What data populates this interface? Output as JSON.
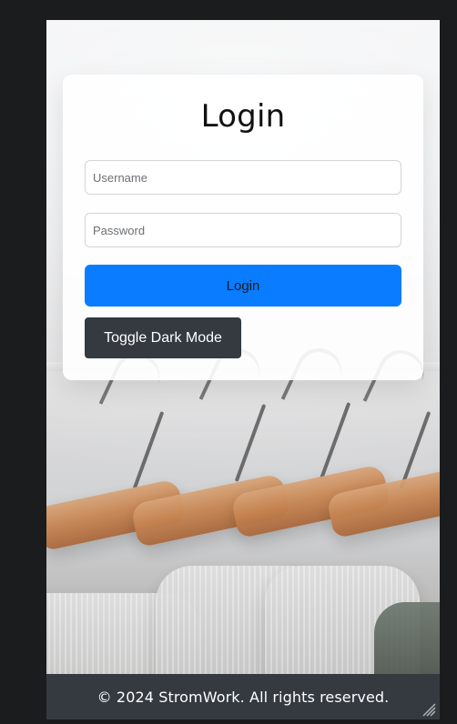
{
  "card": {
    "title": "Login",
    "fields": {
      "username_placeholder": "Username",
      "password_placeholder": "Password"
    },
    "buttons": {
      "login": "Login",
      "toggle_dark_mode": "Toggle Dark Mode"
    }
  },
  "footer": {
    "text": "© 2024 StromWork. All rights reserved."
  },
  "colors": {
    "primary": "#0a7cff",
    "dark": "#343a40"
  },
  "icons": {
    "resize": "resize-grip-icon"
  }
}
